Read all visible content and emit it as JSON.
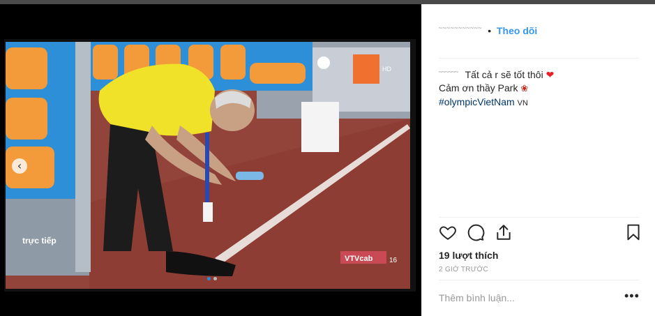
{
  "post": {
    "header": {
      "username": "˜˜˜˜˜˜˜˜˜˜˜",
      "separator": "•",
      "follow_label": "Theo dõi"
    },
    "caption": {
      "username": "˜˜˜˜˜˜",
      "line1": "Tất cả r sẽ tốt thôi",
      "heart": "❤",
      "line2": "Cảm ơn thầy Park",
      "rose": "❀",
      "hashtag": "#olympicVietNam",
      "flag": "VN"
    },
    "likes_text": "19 lượt thích",
    "time_text": "2 GIỜ TRƯỚC",
    "comment_placeholder": "Thêm bình luận...",
    "more_label": "•••"
  },
  "media": {
    "prev_arrow": "‹",
    "screen_text": {
      "truc_tiep": "trực tiếp",
      "vtv": "VTVcab",
      "channel_number": "16",
      "hd": "HD"
    }
  },
  "icons": {
    "like": "heart-icon",
    "comment": "comment-icon",
    "share": "share-icon",
    "save": "bookmark-icon"
  },
  "colors": {
    "follow": "#3897f0",
    "hashtag": "#003569",
    "heart": "#ed1c24"
  }
}
